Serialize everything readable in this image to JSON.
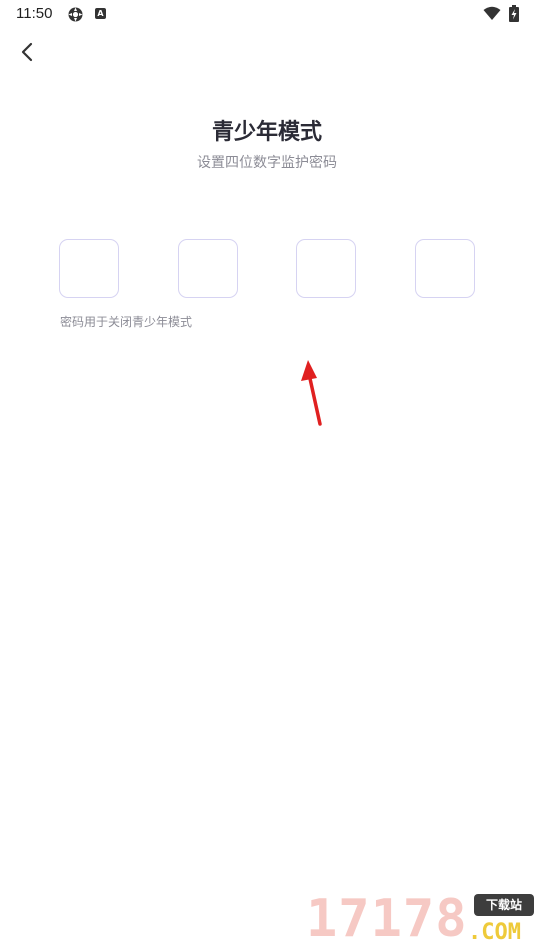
{
  "status_bar": {
    "time": "11:50",
    "icons": [
      "gear-icon",
      "a-badge-icon",
      "wifi-icon",
      "battery-icon"
    ],
    "a_badge": "A"
  },
  "nav": {
    "back_icon": "chevron-left-icon"
  },
  "page": {
    "title": "青少年模式",
    "subtitle": "设置四位数字监护密码",
    "hint": "密码用于关闭青少年模式"
  },
  "code_inputs": [
    "",
    "",
    "",
    ""
  ],
  "watermark": {
    "digits": "17178",
    "badge": "下载站",
    "domain": ".COM"
  },
  "colors": {
    "title": "#2b2b36",
    "secondary_text": "#8c8c96",
    "box_border": "#d6d3f2",
    "arrow": "#e02020",
    "watermark_digits": "#f6c9c4",
    "watermark_com": "#eeca3a"
  }
}
